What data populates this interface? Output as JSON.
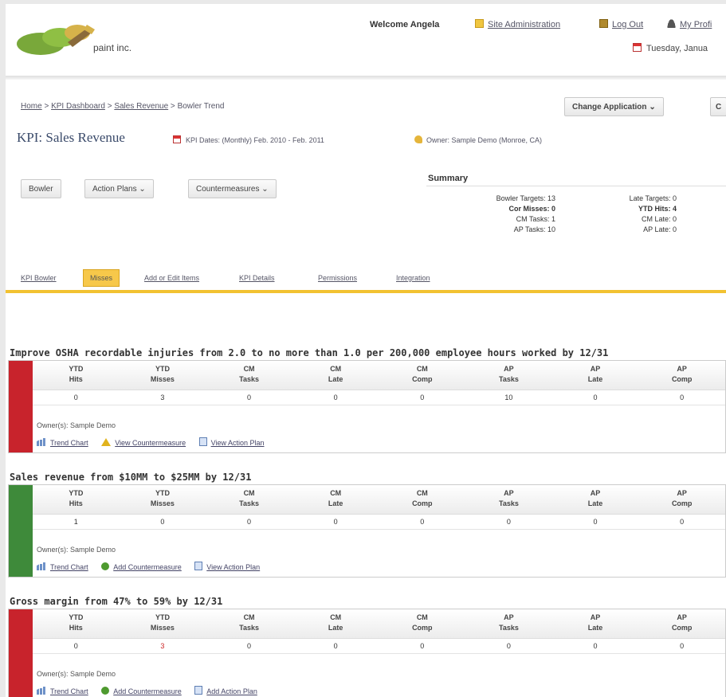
{
  "header": {
    "logo_text": "paint inc.",
    "welcome": "Welcome Angela",
    "links": [
      "Site Administration",
      "Log Out",
      "My Profi"
    ],
    "date": "Tuesday, Janua"
  },
  "breadcrumb": [
    "Home",
    "KPI Dashboard",
    "Sales Revenue",
    "Bowler Trend"
  ],
  "buttons": {
    "change_application": "Change Application",
    "cut_off": "C",
    "bowler": "Bowler",
    "action_plans": "Action Plans",
    "countermeasures": "Countermeasures"
  },
  "kpi": {
    "title": "KPI: Sales Revenue",
    "dates": "KPI Dates: (Monthly) Feb. 2010 - Feb. 2011",
    "owner": "Owner: Sample Demo (Monroe, CA)"
  },
  "summary": {
    "title": "Summary",
    "col1": [
      "Bowler Targets: 13",
      "Cor Misses: 0",
      "CM Tasks: 1",
      "AP Tasks: 10"
    ],
    "col2": [
      "Late Targets: 0",
      "YTD Hits: 4",
      "CM Late: 0",
      "AP Late: 0"
    ]
  },
  "tabs": [
    "KPI Bowler",
    "Misses",
    "Add or Edit Items",
    "KPI Details",
    "Permissions",
    "Integration"
  ],
  "table_headers": [
    [
      "YTD",
      "Hits"
    ],
    [
      "YTD",
      "Misses"
    ],
    [
      "CM",
      "Tasks"
    ],
    [
      "CM",
      "Late"
    ],
    [
      "CM",
      "Comp"
    ],
    [
      "AP",
      "Tasks"
    ],
    [
      "AP",
      "Late"
    ],
    [
      "AP",
      "Comp"
    ]
  ],
  "goals": [
    {
      "title": "Improve OSHA recordable injuries from 2.0 to no more than 1.0 per 200,000 employee hours worked by 12/31",
      "status_color": "#c8232c",
      "values": [
        "0",
        "3",
        "0",
        "0",
        "0",
        "10",
        "0",
        "0"
      ],
      "owner": "Owner(s): Sample Demo",
      "links": [
        "Trend Chart",
        "View Countermeasure",
        "View Action Plan"
      ]
    },
    {
      "title": "Sales revenue from $10MM to $25MM by 12/31",
      "status_color": "#3e8a3a",
      "values": [
        "1",
        "0",
        "0",
        "0",
        "0",
        "0",
        "0",
        "0"
      ],
      "owner": "Owner(s): Sample Demo",
      "links": [
        "Trend Chart",
        "Add Countermeasure",
        "View Action Plan"
      ]
    },
    {
      "title": "Gross margin from 47% to 59% by 12/31",
      "status_color": "#c8232c",
      "values": [
        "0",
        "3",
        "0",
        "0",
        "0",
        "0",
        "0",
        "0"
      ],
      "owner": "Owner(s): Sample Demo",
      "links": [
        "Trend Chart",
        "Add Countermeasure",
        "Add Action Plan"
      ]
    }
  ]
}
